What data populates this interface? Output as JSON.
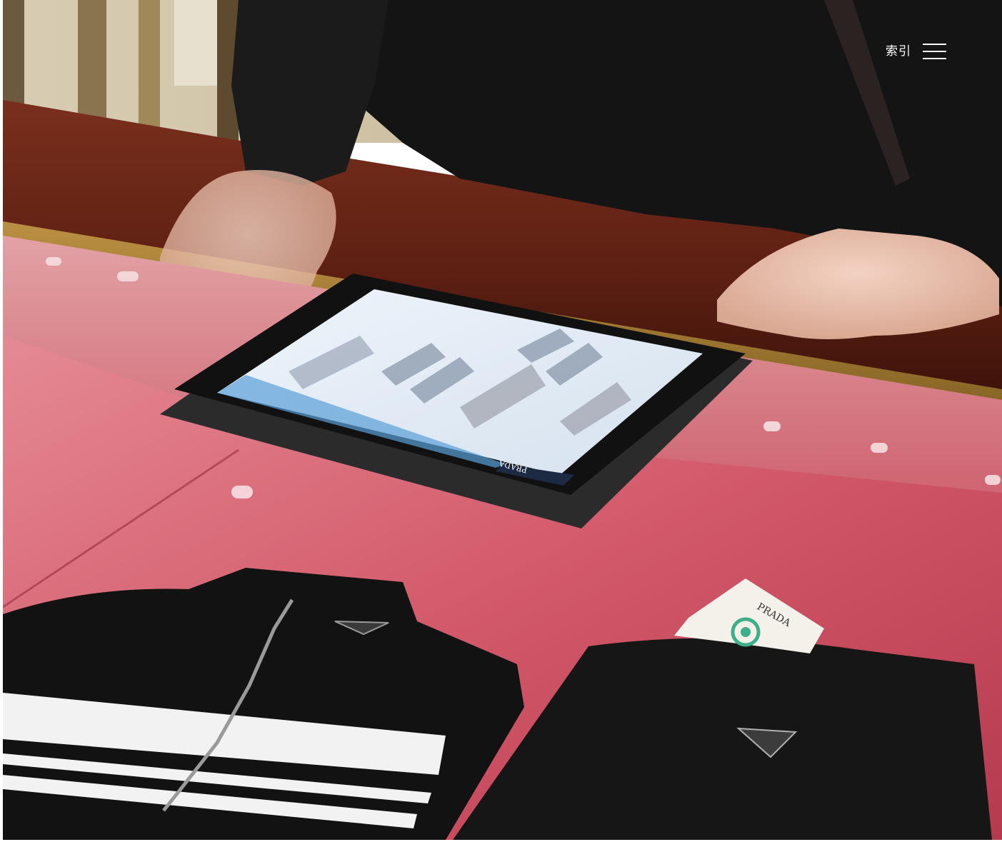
{
  "header": {
    "menu_label": "索引",
    "menu_icon": "hamburger-icon"
  },
  "photo": {
    "tablet_brand": "PRADA",
    "tag_brand": "PRADA",
    "colors": {
      "counter_pink": "#c94a5c",
      "wood": "#6e2a1a",
      "garment_black": "#111111"
    }
  }
}
